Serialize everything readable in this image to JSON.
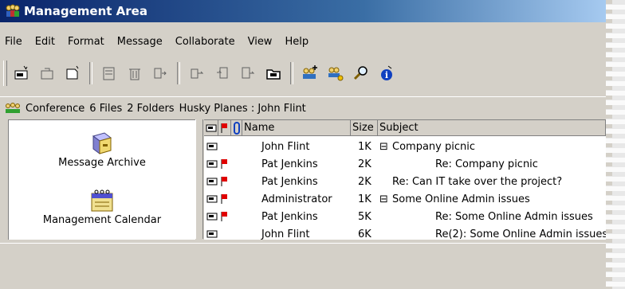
{
  "window": {
    "title": "Management Area",
    "icon": "people-icon"
  },
  "menu": [
    "File",
    "Edit",
    "Format",
    "Message",
    "Collaborate",
    "View",
    "Help"
  ],
  "toolbar": {
    "buttons": [
      "new-message-icon",
      "reply-icon",
      "new-folder-icon",
      "print-icon",
      "delete-icon",
      "move-icon",
      "forward-icon",
      "copy-icon",
      "export-icon",
      "folder-icon",
      "add-user-icon",
      "user-key-icon",
      "search-icon",
      "info-icon"
    ]
  },
  "infobar": {
    "conference": "Conference",
    "files": "6 Files",
    "folders": "2 Folders",
    "path": "Husky Planes : John Flint"
  },
  "left_pane": {
    "items": [
      {
        "label": "Message Archive",
        "icon": "archive-icon"
      },
      {
        "label": "Management Calendar",
        "icon": "calendar-icon"
      }
    ]
  },
  "list": {
    "columns": {
      "name": "Name",
      "size": "Size",
      "subject": "Subject"
    },
    "rows": [
      {
        "flag": false,
        "name": "John Flint",
        "size": "1K",
        "thread": "⊟",
        "subject": "Company picnic",
        "indent": 0
      },
      {
        "flag": true,
        "name": "Pat Jenkins",
        "size": "2K",
        "thread": "",
        "subject": "Re: Company picnic",
        "indent": 1
      },
      {
        "flag": true,
        "name": "Pat Jenkins",
        "size": "2K",
        "thread": "",
        "subject": "Re: Can IT take over the project?",
        "indent": 0
      },
      {
        "flag": true,
        "name": "Administrator",
        "size": "1K",
        "thread": "⊟",
        "subject": "Some Online Admin issues",
        "indent": 0
      },
      {
        "flag": true,
        "name": "Pat Jenkins",
        "size": "5K",
        "thread": "",
        "subject": "Re: Some Online Admin issues",
        "indent": 1
      },
      {
        "flag": false,
        "name": "John Flint",
        "size": "6K",
        "thread": "",
        "subject": "Re(2): Some Online Admin issues",
        "indent": 1
      }
    ]
  },
  "colors": {
    "title_bar": "#0a246a",
    "flag": "#e00000",
    "face": "#d4d0c8"
  }
}
